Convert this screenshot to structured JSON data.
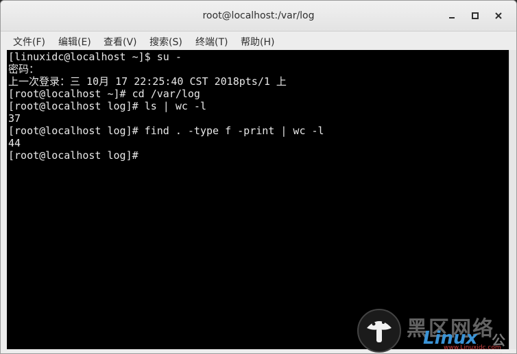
{
  "window": {
    "title": "root@localhost:/var/log",
    "buttons": {
      "minimize": "–",
      "maximize": "□",
      "close": "✕"
    }
  },
  "menubar": {
    "items": [
      {
        "label": "文件(F)"
      },
      {
        "label": "编辑(E)"
      },
      {
        "label": "查看(V)"
      },
      {
        "label": "搜索(S)"
      },
      {
        "label": "终端(T)"
      },
      {
        "label": "帮助(H)"
      }
    ]
  },
  "terminal": {
    "background": "#000000",
    "foreground": "#e8e8e8",
    "lines": [
      "[linuxidc@localhost ~]$ su -",
      "密码：",
      "上一次登录：三 10月 17 22:25:40 CST 2018pts/1 上",
      "[root@localhost ~]# cd /var/log",
      "[root@localhost log]# ls | wc -l",
      "37",
      "[root@localhost log]# find . -type f -print | wc -l",
      "44",
      "[root@localhost log]# "
    ]
  },
  "watermark": {
    "cjk": "黑区网络",
    "brand": "Linux",
    "suffix": "公社",
    "url": "www.Linuxidc.com",
    "logo_icon": "penguin-logo"
  }
}
